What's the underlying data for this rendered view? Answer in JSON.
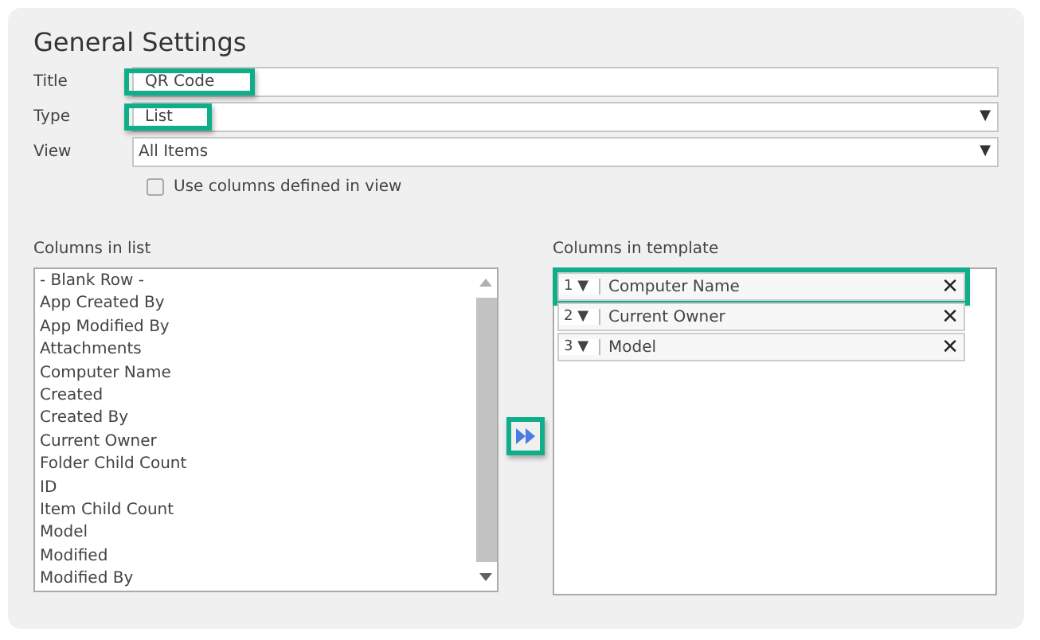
{
  "section_title": "General Settings",
  "fields": [
    {
      "label": "Title",
      "kind": "text",
      "value": "QR Code",
      "highlighted": true
    },
    {
      "label": "Type",
      "kind": "select",
      "value": "List",
      "caret": "▼",
      "highlighted": true
    },
    {
      "label": "View",
      "kind": "select",
      "value": "All Items",
      "caret": "▼",
      "highlighted": false
    }
  ],
  "use_view_columns": {
    "label": "Use columns defined in view",
    "checked": false
  },
  "columns_in_list": {
    "heading": "Columns in list",
    "items": [
      "- Blank Row -",
      "App Created By",
      "App Modified By",
      "Attachments",
      "Computer Name",
      "Created",
      "Created By",
      "Current Owner",
      "Folder Child Count",
      "ID",
      "Item Child Count",
      "Model",
      "Modified",
      "Modified By"
    ]
  },
  "add_button": {
    "highlighted": true
  },
  "columns_in_template": {
    "heading": "Columns in template",
    "rows": [
      {
        "order": "1",
        "caret": "▼",
        "name": "Computer Name",
        "remove": "✕",
        "highlighted": true
      },
      {
        "order": "2",
        "caret": "▼",
        "name": "Current Owner",
        "remove": "✕",
        "highlighted": false
      },
      {
        "order": "3",
        "caret": "▼",
        "name": "Model",
        "remove": "✕",
        "highlighted": false
      }
    ]
  }
}
